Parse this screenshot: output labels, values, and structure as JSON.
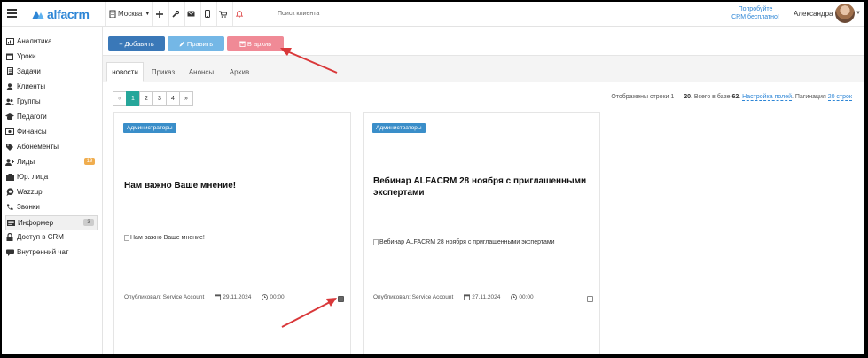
{
  "header": {
    "logo_text": "alfacrm",
    "city": "Москва",
    "search_placeholder": "Поиск клиента",
    "promo_line1": "Попробуйте",
    "promo_line2": "CRM бесплатно!",
    "user_name": "Александра",
    "icons": [
      "menu-icon",
      "building-icon",
      "plus-icon",
      "wrench-icon",
      "envelope-icon",
      "phone-icon",
      "cart-icon",
      "bell-icon"
    ]
  },
  "sidebar": {
    "items": [
      {
        "label": "Аналитика",
        "icon": "chart-icon"
      },
      {
        "label": "Уроки",
        "icon": "calendar-icon"
      },
      {
        "label": "Задачи",
        "icon": "tasks-icon"
      },
      {
        "label": "Клиенты",
        "icon": "user-icon"
      },
      {
        "label": "Группы",
        "icon": "users-icon"
      },
      {
        "label": "Педагоги",
        "icon": "graduation-cap-icon"
      },
      {
        "label": "Финансы",
        "icon": "money-icon"
      },
      {
        "label": "Абонементы",
        "icon": "tag-icon"
      },
      {
        "label": "Лиды",
        "icon": "user-plus-icon",
        "badge": "19"
      },
      {
        "label": "Юр. лица",
        "icon": "briefcase-icon"
      },
      {
        "label": "Wazzup",
        "icon": "whatsapp-icon"
      },
      {
        "label": "Звонки",
        "icon": "phone-icon"
      },
      {
        "label": "Информер",
        "icon": "info-card-icon",
        "badge": "3"
      },
      {
        "label": "Доступ в CRM",
        "icon": "lock-icon"
      },
      {
        "label": "Внутренний чат",
        "icon": "chat-icon"
      }
    ]
  },
  "toolbar": {
    "add_label": "+ Добавить",
    "edit_label": "Править",
    "archive_label": "В архив",
    "colors": {
      "add": "#3a78b8",
      "edit": "#74b7e6",
      "archive": "#f08a96"
    }
  },
  "tabs": [
    {
      "label": "новости",
      "active": true
    },
    {
      "label": "Приказ",
      "active": false
    },
    {
      "label": "Анонсы",
      "active": false
    },
    {
      "label": "Архив",
      "active": false
    }
  ],
  "pagination": {
    "prev": "«",
    "pages": [
      "1",
      "2",
      "3",
      "4"
    ],
    "next": "»",
    "current": "1"
  },
  "row_info": {
    "prefix": "Отображены строки 1 — ",
    "shown_to": "20",
    "mid": ". Всего в базе ",
    "total": "62",
    "suffix": ".",
    "fields_link": "Настройка полей",
    "pagination_label": ". Пагинация",
    "pagination_link": "20 строк"
  },
  "cards": [
    {
      "tag": "Администраторы",
      "title": "Нам важно Ваше мнение!",
      "image_alt": "Нам важно Ваше мнение!",
      "author": "Опубликовал: Service Account",
      "date": "29.11.2024",
      "time": "00:00",
      "checked": true
    },
    {
      "tag": "Администраторы",
      "title": "Вебинар ALFACRM 28 ноября с приглашенными экспертами",
      "image_alt": "Вебинар ALFACRM 28 ноября с приглашенными экспертами",
      "author": "Опубликовал: Service Account",
      "date": "27.11.2024",
      "time": "00:00",
      "checked": false
    }
  ],
  "annotation_color": "#d9383a"
}
